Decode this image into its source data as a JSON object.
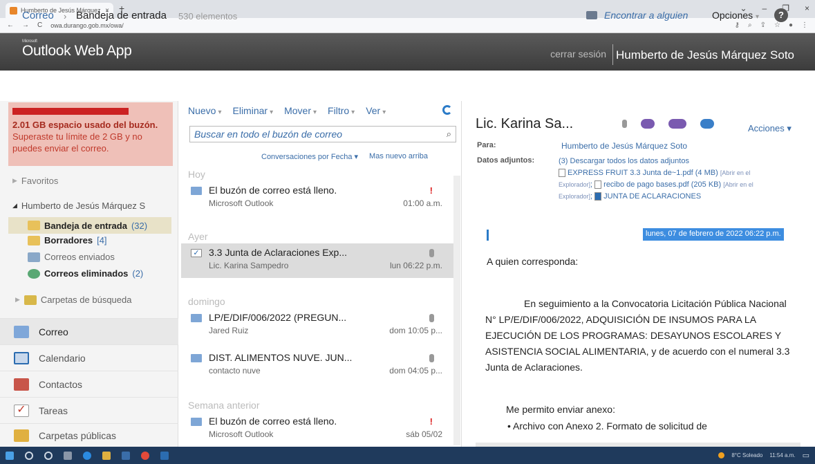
{
  "browser": {
    "tab_title": "Humberto de Jesús Márquez S...",
    "tab_close": "×",
    "new_tab": "+",
    "url": "owa.durango.gob.mx/owa/",
    "nav": [
      "←",
      "→",
      "C"
    ],
    "controls": [
      "⌄",
      "–",
      "❐",
      "×"
    ]
  },
  "header": {
    "microsoft": "Microsoft",
    "app_title": "Outlook Web App",
    "signout": "cerrar sesión",
    "user": "Humberto de Jesús Márquez Soto"
  },
  "breadcrumb": {
    "mail": "Correo",
    "sep": "›",
    "inbox": "Bandeja de entrada",
    "count": "530 elementos",
    "find_people": "Encontrar a alguien",
    "options": "Opciones",
    "options_caret": "▾",
    "help": "?"
  },
  "quota": {
    "bold": "2.01 GB espacio usado del buzón.",
    "rest": " Superaste tu límite de 2 GB y no puedes enviar el correo."
  },
  "nav": {
    "favorites": "Favoritos",
    "account": "Humberto de Jesús Márquez S",
    "folders": [
      {
        "label": "Bandeja de entrada",
        "count": "(32)"
      },
      {
        "label": "Borradores",
        "count": "[4]"
      },
      {
        "label": "Correos enviados",
        "count": ""
      },
      {
        "label": "Correos eliminados",
        "count": "(2)"
      }
    ],
    "search_folders": "Carpetas de búsqueda",
    "modules": [
      "Correo",
      "Calendario",
      "Contactos",
      "Tareas",
      "Carpetas públicas"
    ]
  },
  "toolbar": {
    "new": "Nuevo",
    "delete": "Eliminar",
    "move": "Mover",
    "filter": "Filtro",
    "view": "Ver",
    "caret": "▾"
  },
  "search": {
    "placeholder": "Buscar en todo el buzón de correo",
    "icon": "⌕"
  },
  "sort": {
    "by": "Conversaciones por Fecha ▾",
    "order": "Mas nuevo arriba"
  },
  "groups": {
    "today": "Hoy",
    "yesterday": "Ayer",
    "sunday": "domingo",
    "last_week": "Semana anterior"
  },
  "messages": [
    {
      "subject": "El buzón de correo está lleno.",
      "from": "Microsoft Outlook",
      "time": "01:00 a.m.",
      "imp": "!"
    },
    {
      "subject": "3.3 Junta de Aclaraciones Exp...",
      "from": "Lic. Karina Sampedro",
      "time": "lun 06:22 p.m."
    },
    {
      "subject": "LP/E/DIF/006/2022 (PREGUN...",
      "from": "Jared Ruiz",
      "time": "dom 10:05 p..."
    },
    {
      "subject": "DIST. ALIMENTOS NUVE. JUN...",
      "from": "contacto nuve",
      "time": "dom 04:05 p..."
    },
    {
      "subject": "El buzón de correo está lleno.",
      "from": "Microsoft Outlook",
      "time": "sáb 05/02",
      "imp": "!"
    }
  ],
  "reading": {
    "title": "Lic. Karina Sa...",
    "actions": "Acciones ▾",
    "to_label": "Para:",
    "to": "Humberto de Jesús Márquez Soto",
    "att_label": "Datos adjuntos:",
    "att_count": "(3)",
    "att_download": "Descargar todos los datos adjuntos",
    "att1": "EXPRESS FRUIT 3.3 Junta de~1.pdf (4 MB)",
    "att_open": "[Abrir en el Explorador]",
    "att2": "recibo de pago bases.pdf (205 KB)",
    "att3": "JUNTA DE ACLARACIONES",
    "date": "lunes, 07 de febrero de 2022 06:22 p.m.",
    "greeting": "A quien corresponda:",
    "body": "En seguimiento a la Convocatoria Licitación Pública Nacional N° LP/E/DIF/006/2022, ADQUISICIÓN DE INSUMOS PARA LA EJECUCIÓN DE LOS PROGRAMAS: DESAYUNOS ESCOLARES Y ASISTENCIA SOCIAL ALIMENTARIA, y de acuerdo con el numeral 3.3 Junta de Aclaraciones.",
    "annex": "Me permito enviar anexo:",
    "bullet": "• Archivo con Anexo 2. Formato de solicitud de"
  },
  "taskbar": {
    "weather": "8°C Soleado",
    "clock": "11:54 a.m."
  }
}
